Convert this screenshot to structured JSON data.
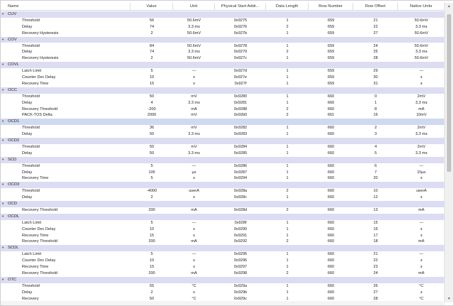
{
  "columns": [
    "Name",
    "Value",
    "Unit",
    "Physical Start Addr...",
    "Data Length",
    "Row Number",
    "Row Offset",
    "Native Units"
  ],
  "groups": [
    {
      "name": "CUV",
      "rows": [
        [
          "Threshold",
          "56",
          "50.6mV",
          "0x9275",
          "1",
          "659",
          "21",
          "50.6mV"
        ],
        [
          "Delay",
          "74",
          "3.3 ms",
          "0x9276",
          "2",
          "659",
          "22",
          "3.3 ms"
        ],
        [
          "Recovery Hysteresis",
          "2",
          "50.6mV",
          "0x927b",
          "1",
          "659",
          "27",
          "50.6mV"
        ]
      ]
    },
    {
      "name": "COV",
      "rows": [
        [
          "Threshold",
          "84",
          "50.6mV",
          "0x9278",
          "1",
          "659",
          "24",
          "50.6mV"
        ],
        [
          "Delay",
          "74",
          "3.3 ms",
          "0x9279",
          "2",
          "659",
          "25",
          "3.3 ms"
        ],
        [
          "Recovery Hysteresis",
          "2",
          "50.6mV",
          "0x927c",
          "1",
          "659",
          "28",
          "50.6mV"
        ]
      ]
    },
    {
      "name": "COVL",
      "rows": [
        [
          "Latch Limit",
          "5",
          "—",
          "0x927d",
          "1",
          "659",
          "29",
          "—"
        ],
        [
          "Counter Dec Delay",
          "10",
          "s",
          "0x927e",
          "1",
          "659",
          "30",
          "s"
        ],
        [
          "Recovery Time",
          "15",
          "s",
          "0x927f",
          "1",
          "659",
          "31",
          "s"
        ]
      ]
    },
    {
      "name": "OCC",
      "rows": [
        [
          "Threshold",
          "50",
          "mV",
          "0x9280",
          "1",
          "660",
          "0",
          "2mV"
        ],
        [
          "Delay",
          "4",
          "3.3 ms",
          "0x9281",
          "1",
          "660",
          "1",
          "3.3 ms"
        ],
        [
          "Recovery Threshold",
          "-200",
          "mA",
          "0x9288",
          "2",
          "660",
          "8",
          "mA"
        ],
        [
          "PACK-TOS Delta",
          "2000",
          "mV",
          "0x92b0",
          "2",
          "661",
          "16",
          "10mV"
        ]
      ]
    },
    {
      "name": "OCD1",
      "selected": true,
      "rows": [
        [
          "Threshold",
          "36",
          "mV",
          "0x9282",
          "1",
          "660",
          "2",
          "2mV"
        ],
        [
          "Delay",
          "50",
          "3.3 ms",
          "0x9283",
          "1",
          "660",
          "3",
          "3.3 ms"
        ]
      ]
    },
    {
      "name": "OCD2",
      "rows": [
        [
          "Threshold",
          "50",
          "mV",
          "0x9284",
          "1",
          "660",
          "4",
          "2mV"
        ],
        [
          "Delay",
          "50",
          "3.3 ms",
          "0x9285",
          "1",
          "660",
          "5",
          "3.3 ms"
        ]
      ]
    },
    {
      "name": "SCD",
      "rows": [
        [
          "Threshold",
          "5",
          "—",
          "0x9286",
          "1",
          "660",
          "6",
          "—"
        ],
        [
          "Delay",
          "105",
          "µs",
          "0x9287",
          "1",
          "660",
          "7",
          "15µs"
        ],
        [
          "Recovery Time",
          "5",
          "s",
          "0x9294",
          "1",
          "660",
          "20",
          "s"
        ]
      ]
    },
    {
      "name": "OCD3",
      "rows": [
        [
          "Threshold",
          "-4000",
          "userA",
          "0x928a",
          "2",
          "660",
          "10",
          "userA"
        ],
        [
          "Delay",
          "2",
          "s",
          "0x928c",
          "1",
          "660",
          "12",
          "s"
        ]
      ]
    },
    {
      "name": "OCD",
      "rows": [
        [
          "Recovery Threshold",
          "200",
          "mA",
          "0x928d",
          "2",
          "660",
          "13",
          "mA"
        ]
      ]
    },
    {
      "name": "OCDL",
      "rows": [
        [
          "Latch Limit",
          "5",
          "—",
          "0x928f",
          "1",
          "660",
          "15",
          "—"
        ],
        [
          "Counter Dec Delay",
          "10",
          "s",
          "0x9290",
          "1",
          "660",
          "16",
          "s"
        ],
        [
          "Recovery Time",
          "15",
          "s",
          "0x9291",
          "1",
          "660",
          "17",
          "s"
        ],
        [
          "Recovery Threshold",
          "200",
          "mA",
          "0x9292",
          "2",
          "660",
          "18",
          "mA"
        ]
      ]
    },
    {
      "name": "SCDL",
      "rows": [
        [
          "Latch Limit",
          "5",
          "—",
          "0x9295",
          "1",
          "660",
          "21",
          "—"
        ],
        [
          "Counter Dec Delay",
          "10",
          "s",
          "0x9296",
          "1",
          "660",
          "22",
          "s"
        ],
        [
          "Recovery Time",
          "15",
          "s",
          "0x9297",
          "1",
          "660",
          "23",
          "s"
        ],
        [
          "Recovery Threshold",
          "200",
          "mA",
          "0x9298",
          "2",
          "660",
          "24",
          "mA"
        ]
      ]
    },
    {
      "name": "OTC",
      "rows": [
        [
          "Threshold",
          "55",
          "°C",
          "0x929a",
          "1",
          "660",
          "26",
          "°C"
        ],
        [
          "Delay",
          "2",
          "s",
          "0x929b",
          "1",
          "660",
          "27",
          "s"
        ],
        [
          "Recovery",
          "50",
          "°C",
          "0x929c",
          "1",
          "660",
          "28",
          "°C"
        ]
      ]
    }
  ],
  "icons": {
    "expand": "triangle-down-icon",
    "scroll_up": "arrow-up-icon",
    "scroll_down": "arrow-down-icon"
  }
}
